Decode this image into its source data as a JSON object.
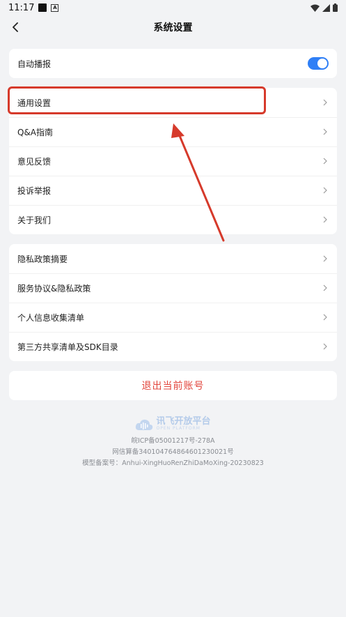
{
  "status": {
    "time": "11:17"
  },
  "header": {
    "title": "系统设置"
  },
  "section1": {
    "auto_broadcast_label": "自动播报",
    "auto_broadcast_on": true
  },
  "section2": {
    "items": [
      {
        "label": "通用设置"
      },
      {
        "label": "Q&A指南"
      },
      {
        "label": "意见反馈"
      },
      {
        "label": "投诉举报"
      },
      {
        "label": "关于我们"
      }
    ]
  },
  "section3": {
    "items": [
      {
        "label": "隐私政策摘要"
      },
      {
        "label": "服务协议&隐私政策"
      },
      {
        "label": "个人信息收集清单"
      },
      {
        "label": "第三方共享清单及SDK目录"
      }
    ]
  },
  "logout": {
    "label": "退出当前账号"
  },
  "footer": {
    "logo_text": "讯飞开放平台",
    "logo_sub": "OPEN PLATFORM",
    "icp": "皖ICP备05001217号-278A",
    "algo": "网信算备340104764864601230021号",
    "model": "模型备案号：Anhui-XingHuoRenZhiDaMoXing-20230823"
  },
  "colors": {
    "accent": "#2f7ff6",
    "danger": "#e2463d",
    "annotation": "#d63a2b"
  }
}
